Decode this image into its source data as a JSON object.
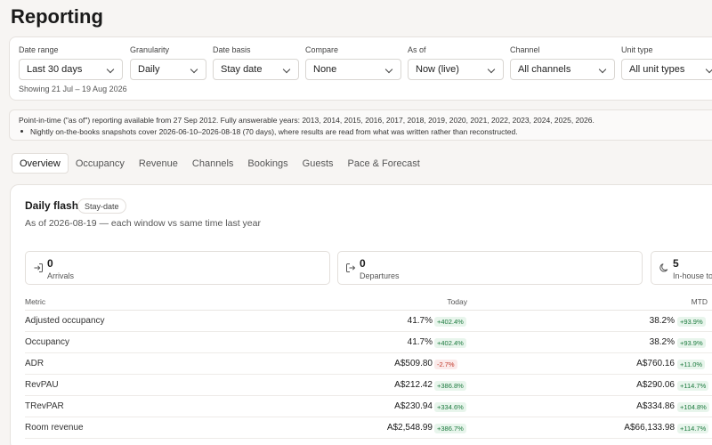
{
  "page": {
    "title": "Reporting"
  },
  "filters": [
    {
      "label": "Date range",
      "value": "Last 30 days"
    },
    {
      "label": "Granularity",
      "value": "Daily"
    },
    {
      "label": "Date basis",
      "value": "Stay date"
    },
    {
      "label": "Compare",
      "value": "None"
    },
    {
      "label": "As of",
      "value": "Now (live)"
    },
    {
      "label": "Channel",
      "value": "All channels"
    },
    {
      "label": "Unit type",
      "value": "All unit types"
    }
  ],
  "showing": "Showing 21 Jul – 19 Aug 2026",
  "notice": {
    "line1": "Point-in-time (\"as of\") reporting available from 27 Sep 2012. Fully answerable years: 2013, 2014, 2015, 2016, 2017, 2018, 2019, 2020, 2021, 2022, 2023, 2024, 2025, 2026.",
    "line2": "Nightly on-the-books snapshots cover 2026-06-10–2026-08-18 (70 days), where results are read from what was written rather than reconstructed."
  },
  "tabs": [
    "Overview",
    "Occupancy",
    "Revenue",
    "Channels",
    "Bookings",
    "Guests",
    "Pace & Forecast"
  ],
  "card": {
    "title": "Daily flash",
    "badge": "Stay-date",
    "subtitle": "As of 2026-08-19 — each window vs same time last year",
    "kpis": [
      {
        "value": "0",
        "label": "Arrivals",
        "icon": "arrivals-icon"
      },
      {
        "value": "0",
        "label": "Departures",
        "icon": "departures-icon"
      },
      {
        "value": "5",
        "label": "In-house tonight",
        "icon": "moon-icon"
      }
    ],
    "table": {
      "headers": {
        "metric": "Metric",
        "today": "Today",
        "mtd": "MTD"
      },
      "rows": [
        {
          "metric": "Adjusted occupancy",
          "today": "41.7%",
          "today_change": "+402.4%",
          "today_dir": "pos",
          "mtd": "38.2%",
          "mtd_change": "+93.9%",
          "mtd_dir": "pos"
        },
        {
          "metric": "Occupancy",
          "today": "41.7%",
          "today_change": "+402.4%",
          "today_dir": "pos",
          "mtd": "38.2%",
          "mtd_change": "+93.9%",
          "mtd_dir": "pos"
        },
        {
          "metric": "ADR",
          "today": "A$509.80",
          "today_change": "-2.7%",
          "today_dir": "neg",
          "mtd": "A$760.16",
          "mtd_change": "+11.0%",
          "mtd_dir": "pos"
        },
        {
          "metric": "RevPAU",
          "today": "A$212.42",
          "today_change": "+386.8%",
          "today_dir": "pos",
          "mtd": "A$290.06",
          "mtd_change": "+114.7%",
          "mtd_dir": "pos"
        },
        {
          "metric": "TRevPAR",
          "today": "A$230.94",
          "today_change": "+334.6%",
          "today_dir": "pos",
          "mtd": "A$334.86",
          "mtd_change": "+104.8%",
          "mtd_dir": "pos"
        },
        {
          "metric": "Room revenue",
          "today": "A$2,548.99",
          "today_change": "+386.7%",
          "today_dir": "pos",
          "mtd": "A$66,133.98",
          "mtd_change": "+114.7%",
          "mtd_dir": "pos"
        }
      ]
    }
  },
  "colors": {
    "positive": "#1c7a3e",
    "negative": "#c0392b",
    "background": "#f7f5f3"
  }
}
